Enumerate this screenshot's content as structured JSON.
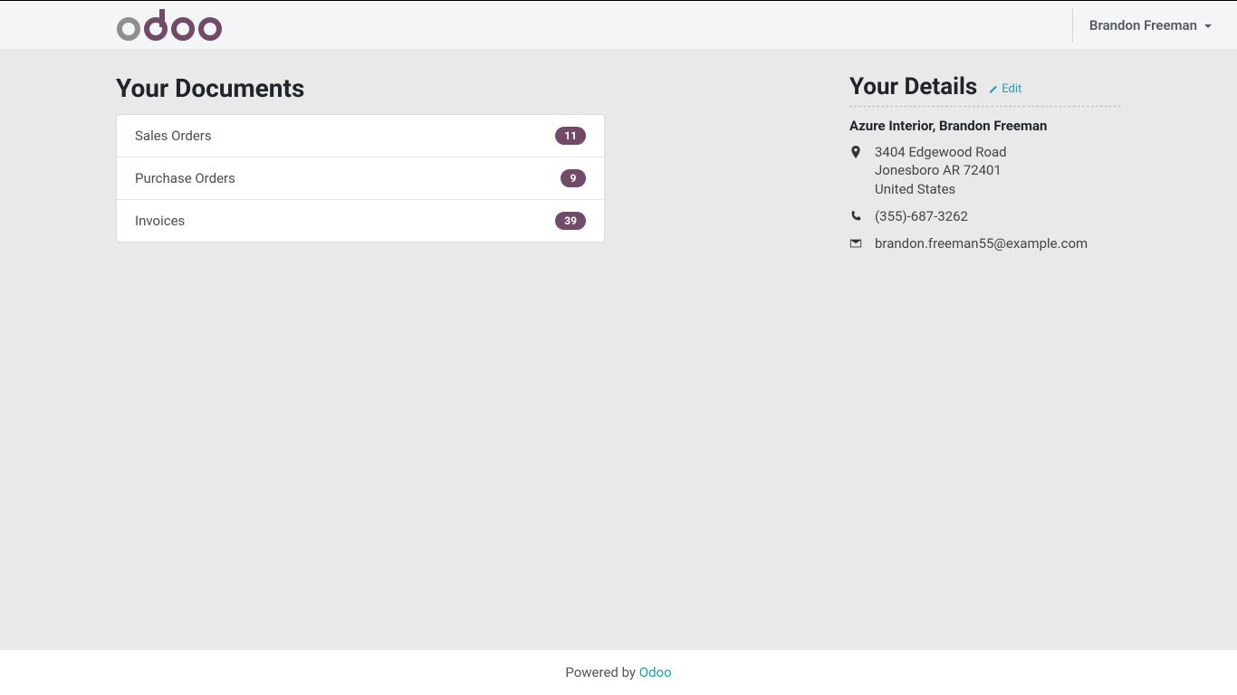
{
  "header": {
    "user_name": "Brandon Freeman"
  },
  "docs": {
    "title": "Your Documents",
    "items": [
      {
        "label": "Sales Orders",
        "count": "11"
      },
      {
        "label": "Purchase Orders",
        "count": "9"
      },
      {
        "label": "Invoices",
        "count": "39"
      }
    ]
  },
  "details": {
    "title": "Your Details",
    "edit_label": "Edit",
    "name": "Azure Interior, Brandon Freeman",
    "address_line1": "3404 Edgewood Road",
    "address_line2": "Jonesboro AR 72401",
    "address_line3": "United States",
    "phone": "(355)-687-3262",
    "email": "brandon.freeman55@example.com"
  },
  "footer": {
    "powered_by": "Powered by ",
    "brand": "Odoo"
  }
}
